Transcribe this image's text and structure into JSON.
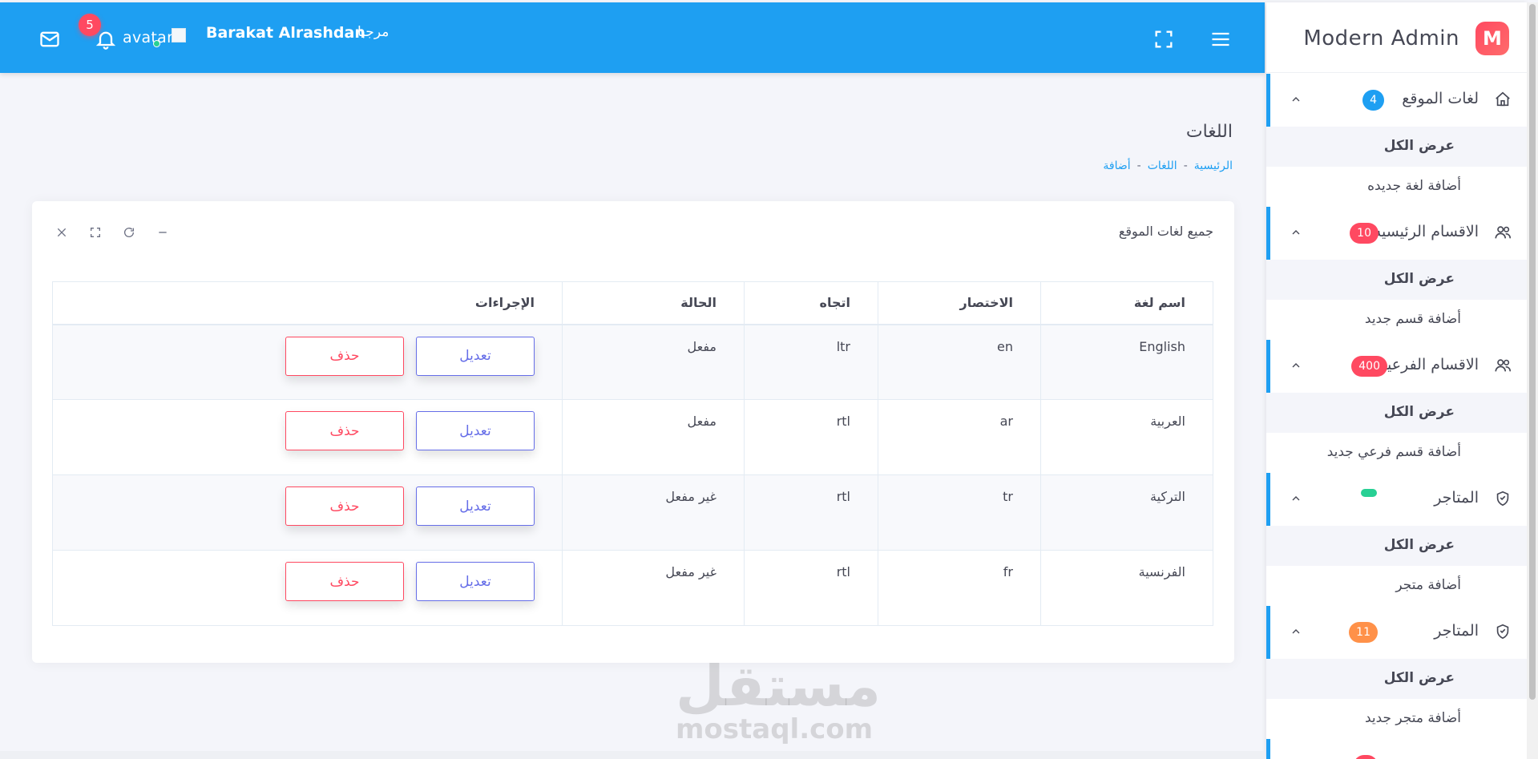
{
  "navbar": {
    "notification_count": "5",
    "avatar_alt": "avatar",
    "user_name": "Barakat Alrashdan",
    "greeting": "مرجبا",
    "icons": [
      "mail-icon",
      "bell-icon",
      "fullscreen-icon",
      "hamburger-icon"
    ],
    "color": "#1e9ff2"
  },
  "sidebar": {
    "brand": "Modern Admin",
    "brand_logo": "M",
    "groups": [
      {
        "label": "لغات الموقع",
        "badge": "4",
        "badge_color": "#1e9ff2",
        "icon": "home-icon",
        "items": [
          "عرض الكل",
          "أضافة لغة جديده"
        ]
      },
      {
        "label": "الاقسام الرئيسيه",
        "badge": "10",
        "badge_color": "#ff4961",
        "icon": "users-icon",
        "items": [
          "عرض الكل",
          "أضافة قسم جديد"
        ]
      },
      {
        "label": "الاقسام الفرعية",
        "badge": "400",
        "badge_color": "#ff4961",
        "icon": "users-icon",
        "items": [
          "عرض الكل",
          "أضافة قسم فرعي جديد"
        ]
      },
      {
        "label": "المتاجر",
        "badge": "",
        "badge_color": "#28d094",
        "icon": "shield-icon",
        "items": [
          "عرض الكل",
          "أضافة متجر"
        ]
      },
      {
        "label": "المتاجر",
        "badge": "11",
        "badge_color": "#ff9149",
        "icon": "shield-icon",
        "items": [
          "عرض الكل",
          "أضافة متجر جديد"
        ]
      }
    ]
  },
  "page": {
    "title": "اللغات",
    "breadcrumb": [
      "الرئيسية",
      "اللغات",
      "أضافة"
    ]
  },
  "card": {
    "title": "جميع لغات الموقع",
    "tools": [
      "minimize-icon",
      "reload-icon",
      "expand-icon",
      "close-icon"
    ]
  },
  "table": {
    "headers": [
      "اسم لغة",
      "الاختصار",
      "اتجاه",
      "الحالة",
      "الإجراءات"
    ],
    "rows": [
      {
        "name": "English",
        "abbr": "en",
        "direction": "ltr",
        "status": "مفعل"
      },
      {
        "name": "العربية",
        "abbr": "ar",
        "direction": "rtl",
        "status": "مفعل"
      },
      {
        "name": "التركية",
        "abbr": "tr",
        "direction": "rtl",
        "status": "غير مفعل"
      },
      {
        "name": "الفرنسية",
        "abbr": "fr",
        "direction": "rtl",
        "status": "غير مفعل"
      }
    ],
    "edit_label": "تعديل",
    "delete_label": "حذف"
  },
  "watermark": {
    "arabic": "مستقل",
    "latin": "mostaql.com"
  },
  "colors": {
    "primary": "#1e9ff2",
    "danger": "#ff4961",
    "edit": "#666ee8",
    "success": "#28d094",
    "warning": "#ff9149"
  }
}
